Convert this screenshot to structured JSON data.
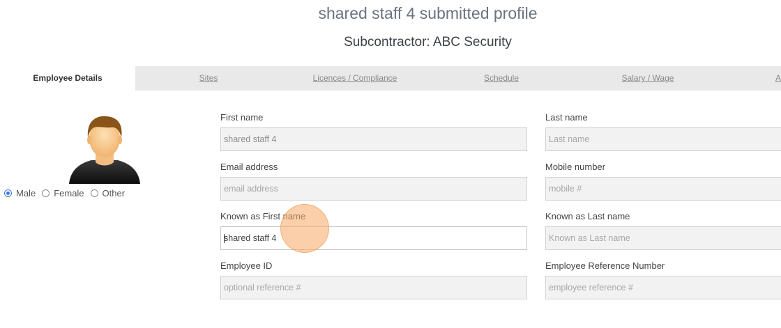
{
  "header": {
    "title": "shared staff 4 submitted profile",
    "subtitle": "Subcontractor: ABC Security"
  },
  "tabs": [
    {
      "label": "Employee Details",
      "active": true
    },
    {
      "label": "Sites"
    },
    {
      "label": "Licences / Compliance"
    },
    {
      "label": "Schedule"
    },
    {
      "label": "Salary / Wage"
    },
    {
      "label": "A"
    }
  ],
  "profile": {
    "avatar_icon": "male-user-avatar-icon",
    "gender": {
      "options": [
        "Male",
        "Female",
        "Other"
      ],
      "selected": "Male"
    }
  },
  "form": {
    "first_name": {
      "label": "First name",
      "value": "shared staff 4",
      "placeholder": "First name"
    },
    "last_name": {
      "label": "Last name",
      "value": "",
      "placeholder": "Last name"
    },
    "email": {
      "label": "Email address",
      "value": "",
      "placeholder": "email address"
    },
    "mobile": {
      "label": "Mobile number",
      "value": "",
      "placeholder": "mobile #"
    },
    "known_first": {
      "label": "Known as First name",
      "value": "shared staff 4",
      "placeholder": "Known as First name"
    },
    "known_last": {
      "label": "Known as Last name",
      "value": "",
      "placeholder": "Known as Last name"
    },
    "employee_id": {
      "label": "Employee ID",
      "value": "",
      "placeholder": "optional reference #"
    },
    "employee_ref": {
      "label": "Employee Reference Number",
      "value": "",
      "placeholder": "employee reference #"
    }
  },
  "colors": {
    "accent": "#3b7be0",
    "click_indicator": "#f7a864"
  }
}
